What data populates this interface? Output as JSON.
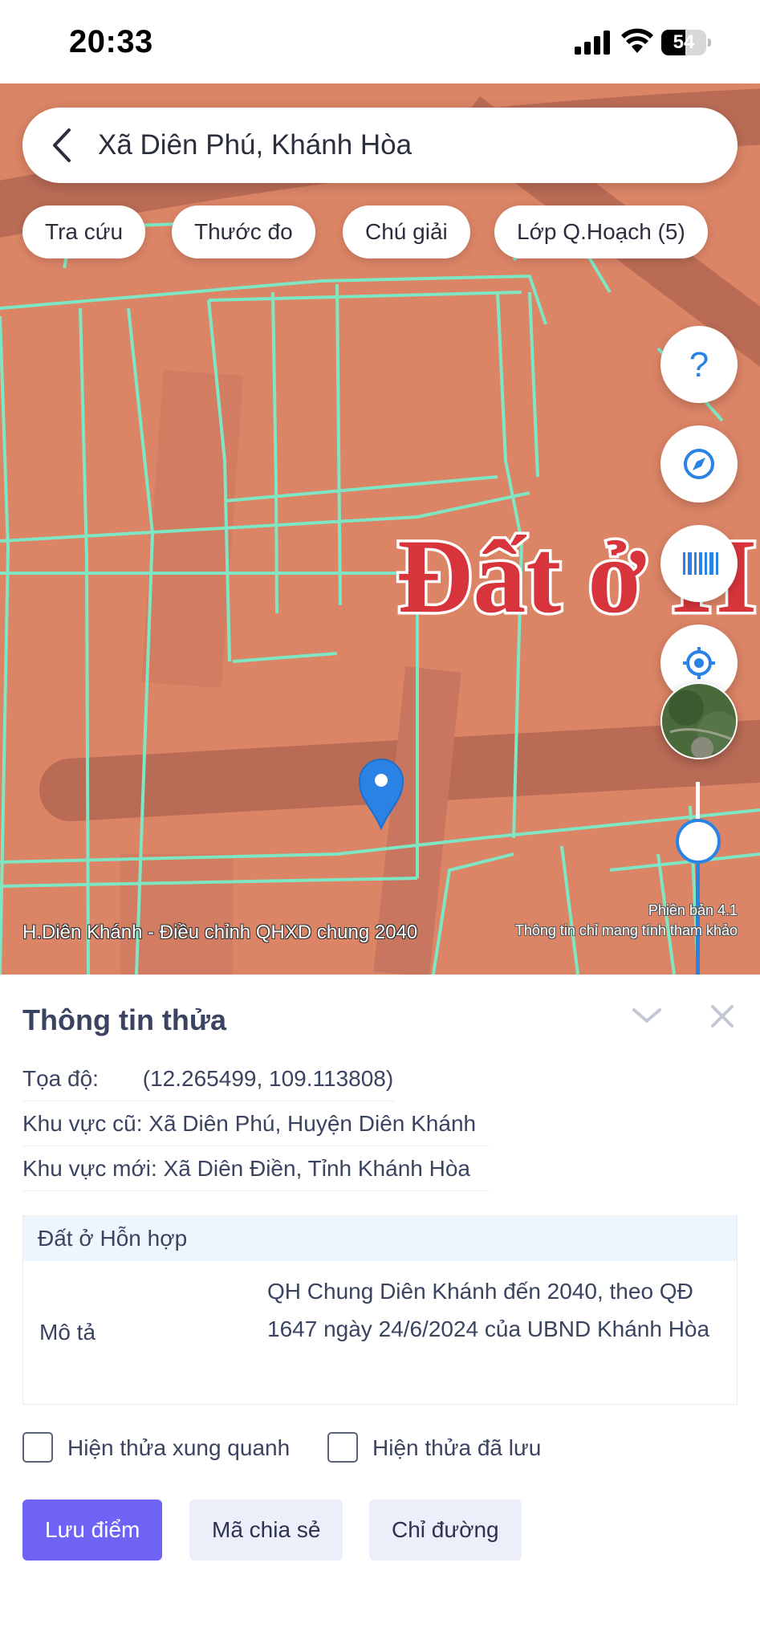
{
  "status_bar": {
    "time": "20:33",
    "battery_level": "54",
    "battery_percent": 54
  },
  "search": {
    "text": "Xã Diên Phú, Khánh Hòa"
  },
  "chips": [
    {
      "label": "Tra cứu"
    },
    {
      "label": "Thước đo"
    },
    {
      "label": "Chú giải"
    },
    {
      "label": "Lớp Q.Hoạch (5)"
    }
  ],
  "map_buttons": [
    {
      "icon": "help-icon",
      "label": "?"
    },
    {
      "icon": "compass-icon"
    },
    {
      "icon": "barcode-icon"
    },
    {
      "icon": "my-location-icon"
    },
    {
      "icon": "satellite-layer-icon"
    }
  ],
  "map": {
    "overlay_label": "Đất ở H",
    "caption": "H.Diên Khánh - Điều chỉnh QHXD chung 2040",
    "version": "Phiên bản 4.1",
    "note": "Thông tin chỉ mang tính tham khảo",
    "colors": {
      "residential": "#db8466",
      "road": "#b96b55",
      "parcel_line": "#7fe6c3",
      "pin": "#2a82e4"
    }
  },
  "panel": {
    "title": "Thông tin thửa",
    "rows": [
      {
        "label": "Tọa độ:",
        "value": "(12.265499, 109.113808)"
      },
      {
        "label": "Khu vực cũ:",
        "value": "Xã Diên Phú, Huyện Diên Khánh"
      },
      {
        "label": "Khu vực mới:",
        "value": "Xã Diên Điền, Tỉnh Khánh Hòa"
      }
    ],
    "land_use": {
      "type": "Đất ở Hỗn hợp",
      "description_label": "Mô tả",
      "description": "QH Chung Diên Khánh đến 2040, theo QĐ 1647 ngày 24/6/2024 của UBND Khánh Hòa"
    },
    "checkboxes": [
      {
        "label": "Hiện thửa xung quanh",
        "checked": false
      },
      {
        "label": "Hiện thửa đã lưu",
        "checked": false
      }
    ],
    "buttons": {
      "save": "Lưu điểm",
      "share_code": "Mã chia sẻ",
      "directions": "Chỉ đường"
    },
    "colors": {
      "primary": "#6f63f6",
      "secondary": "#eceffa"
    }
  }
}
